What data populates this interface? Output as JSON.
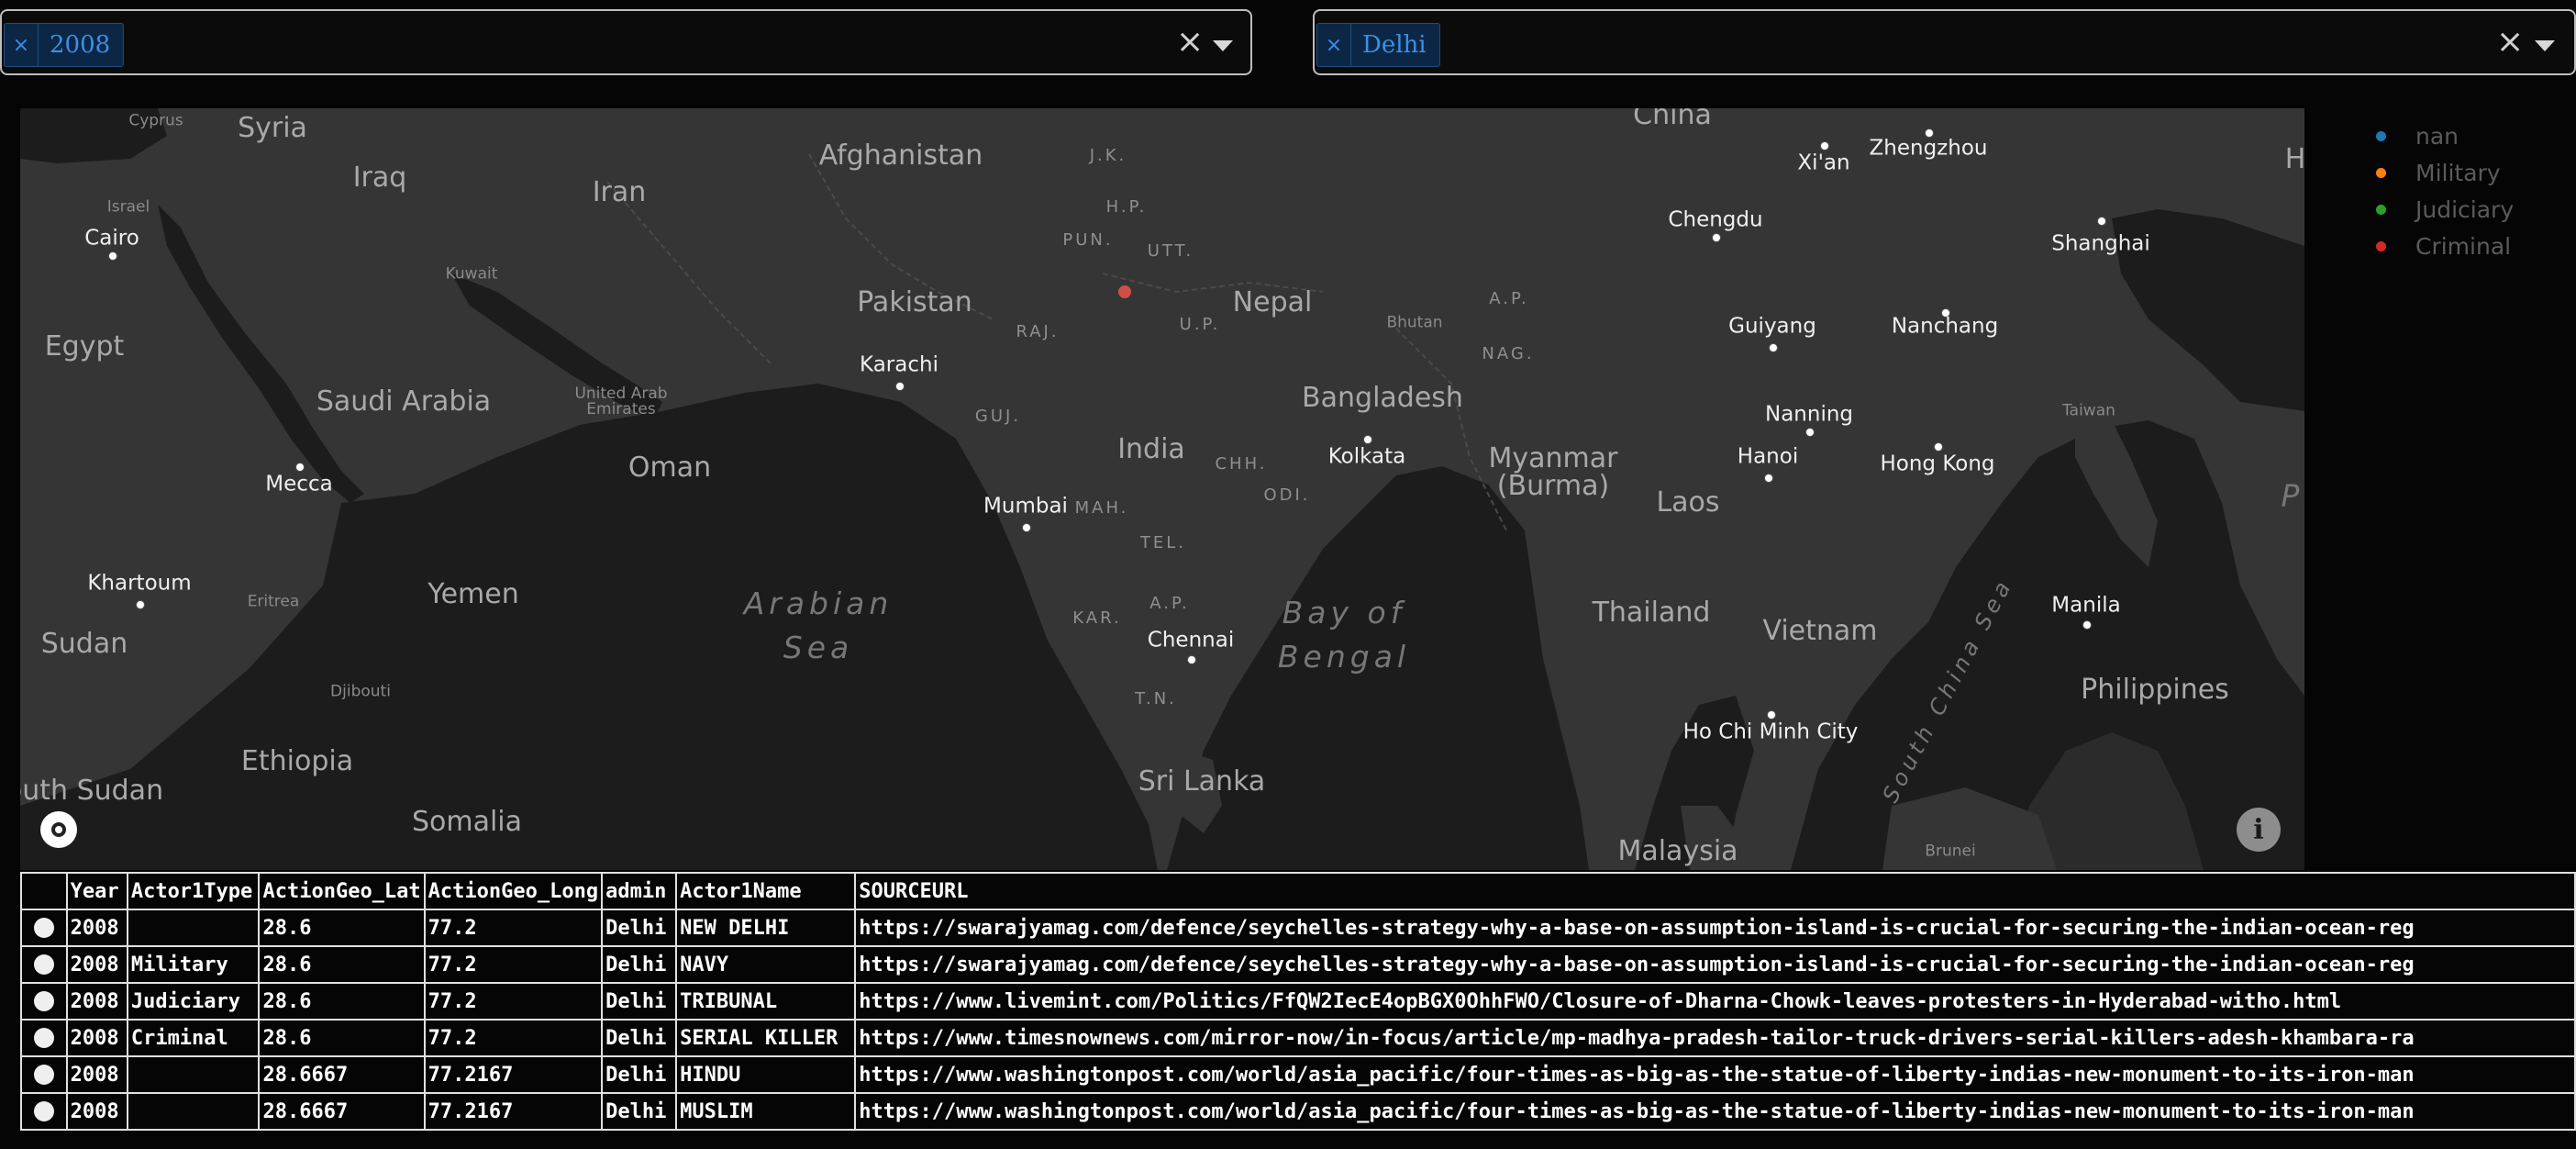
{
  "filters": {
    "year": {
      "selected": "2008",
      "remove_glyph": "×",
      "clear_glyph": "×",
      "caret_icon": "chevron-down-icon"
    },
    "state": {
      "selected": "Delhi",
      "remove_glyph": "×",
      "clear_glyph": "×",
      "caret_icon": "chevron-down-icon"
    }
  },
  "map": {
    "labels": {
      "cyprus": "Cyprus",
      "syria": "Syria",
      "iraq": "Iraq",
      "iran": "Iran",
      "afghanistan": "Afghanistan",
      "jk": "J.K.",
      "hp": "H.P.",
      "pun": "PUN.",
      "utt": "UTT.",
      "china": "China",
      "xian": "Xi'an",
      "zhengzhou": "Zhengzhou",
      "chengdu": "Chengdu",
      "shanghai": "Shanghai",
      "cairo": "Cairo",
      "israel": "Israel",
      "kuwait": "Kuwait",
      "pakistan": "Pakistan",
      "raj": "RAJ.",
      "up": "U.P.",
      "nepal": "Nepal",
      "bhutan": "Bhutan",
      "ap_ne": "A.P.",
      "nag": "NAG.",
      "nanchang": "Nanchang",
      "guiyang": "Guiyang",
      "egypt": "Egypt",
      "karachi": "Karachi",
      "saudi_arabia": "Saudi Arabia",
      "uae": "United Arab\nEmirates",
      "guj": "GUJ.",
      "bangladesh": "Bangladesh",
      "nanning": "Nanning",
      "taiwan": "Taiwan",
      "india": "India",
      "chh": "CHH.",
      "kolkata": "Kolkata",
      "myanmar": "Myanmar\n(Burma)",
      "hanoi": "Hanoi",
      "hong_kong": "Hong Kong",
      "mecca": "Mecca",
      "oman": "Oman",
      "mumbai": "Mumbai",
      "mah": "MAH.",
      "odi": "ODI.",
      "laos": "Laos",
      "tel": "TEL.",
      "khartoum": "Khartoum",
      "eritrea": "Eritrea",
      "yemen": "Yemen",
      "arabian_sea": "Arabian\nSea",
      "bay_of_bengal": "Bay of\nBengal",
      "kar": "KAR.",
      "ap_south": "A.P.",
      "chennai": "Chennai",
      "thailand": "Thailand",
      "vietnam": "Vietnam",
      "south_china_sea": "South China Sea",
      "manila": "Manila",
      "sudan": "Sudan",
      "djibouti": "Djibouti",
      "tn": "T.N.",
      "philippines": "Philippines",
      "ho_chi_minh": "Ho Chi Minh City",
      "ethiopia": "Ethiopia",
      "sri_lanka": "Sri Lanka",
      "south_sudan": "outh Sudan",
      "somalia": "Somalia",
      "malaysia": "Malaysia",
      "brunei": "Brunei",
      "h_edge": "H",
      "p_edge": "P"
    },
    "logo_icon": "mapbox-logo-icon",
    "info_glyph": "i",
    "data_point_color": "#e0524a"
  },
  "legend": [
    {
      "label": "nan",
      "color": "#1f77b4"
    },
    {
      "label": "Military",
      "color": "#ff7f0e"
    },
    {
      "label": "Judiciary",
      "color": "#2ca02c"
    },
    {
      "label": "Criminal",
      "color": "#d62728"
    }
  ],
  "table": {
    "headers": [
      "",
      "Year",
      "Actor1Type",
      "ActionGeo_Lat",
      "ActionGeo_Long",
      "admin",
      "Actor1Name",
      "SOURCEURL"
    ],
    "rows": [
      [
        "2008",
        "",
        "28.6",
        "77.2",
        "Delhi",
        "NEW DELHI",
        "https://swarajyamag.com/defence/seychelles-strategy-why-a-base-on-assumption-island-is-crucial-for-securing-the-indian-ocean-reg"
      ],
      [
        "2008",
        "Military",
        "28.6",
        "77.2",
        "Delhi",
        "NAVY",
        "https://swarajyamag.com/defence/seychelles-strategy-why-a-base-on-assumption-island-is-crucial-for-securing-the-indian-ocean-reg"
      ],
      [
        "2008",
        "Judiciary",
        "28.6",
        "77.2",
        "Delhi",
        "TRIBUNAL",
        "https://www.livemint.com/Politics/FfQW2IecE4opBGX0OhhFWO/Closure-of-Dharna-Chowk-leaves-protesters-in-Hyderabad-witho.html"
      ],
      [
        "2008",
        "Criminal",
        "28.6",
        "77.2",
        "Delhi",
        "SERIAL KILLER",
        "https://www.timesnownews.com/mirror-now/in-focus/article/mp-madhya-pradesh-tailor-truck-drivers-serial-killers-adesh-khambara-ra"
      ],
      [
        "2008",
        "",
        "28.6667",
        "77.2167",
        "Delhi",
        "HINDU",
        "https://www.washingtonpost.com/world/asia_pacific/four-times-as-big-as-the-statue-of-liberty-indias-new-monument-to-its-iron-man"
      ],
      [
        "2008",
        "",
        "28.6667",
        "77.2167",
        "Delhi",
        "MUSLIM",
        "https://www.washingtonpost.com/world/asia_pacific/four-times-as-big-as-the-statue-of-liberty-indias-new-monument-to-its-iron-man"
      ]
    ]
  }
}
